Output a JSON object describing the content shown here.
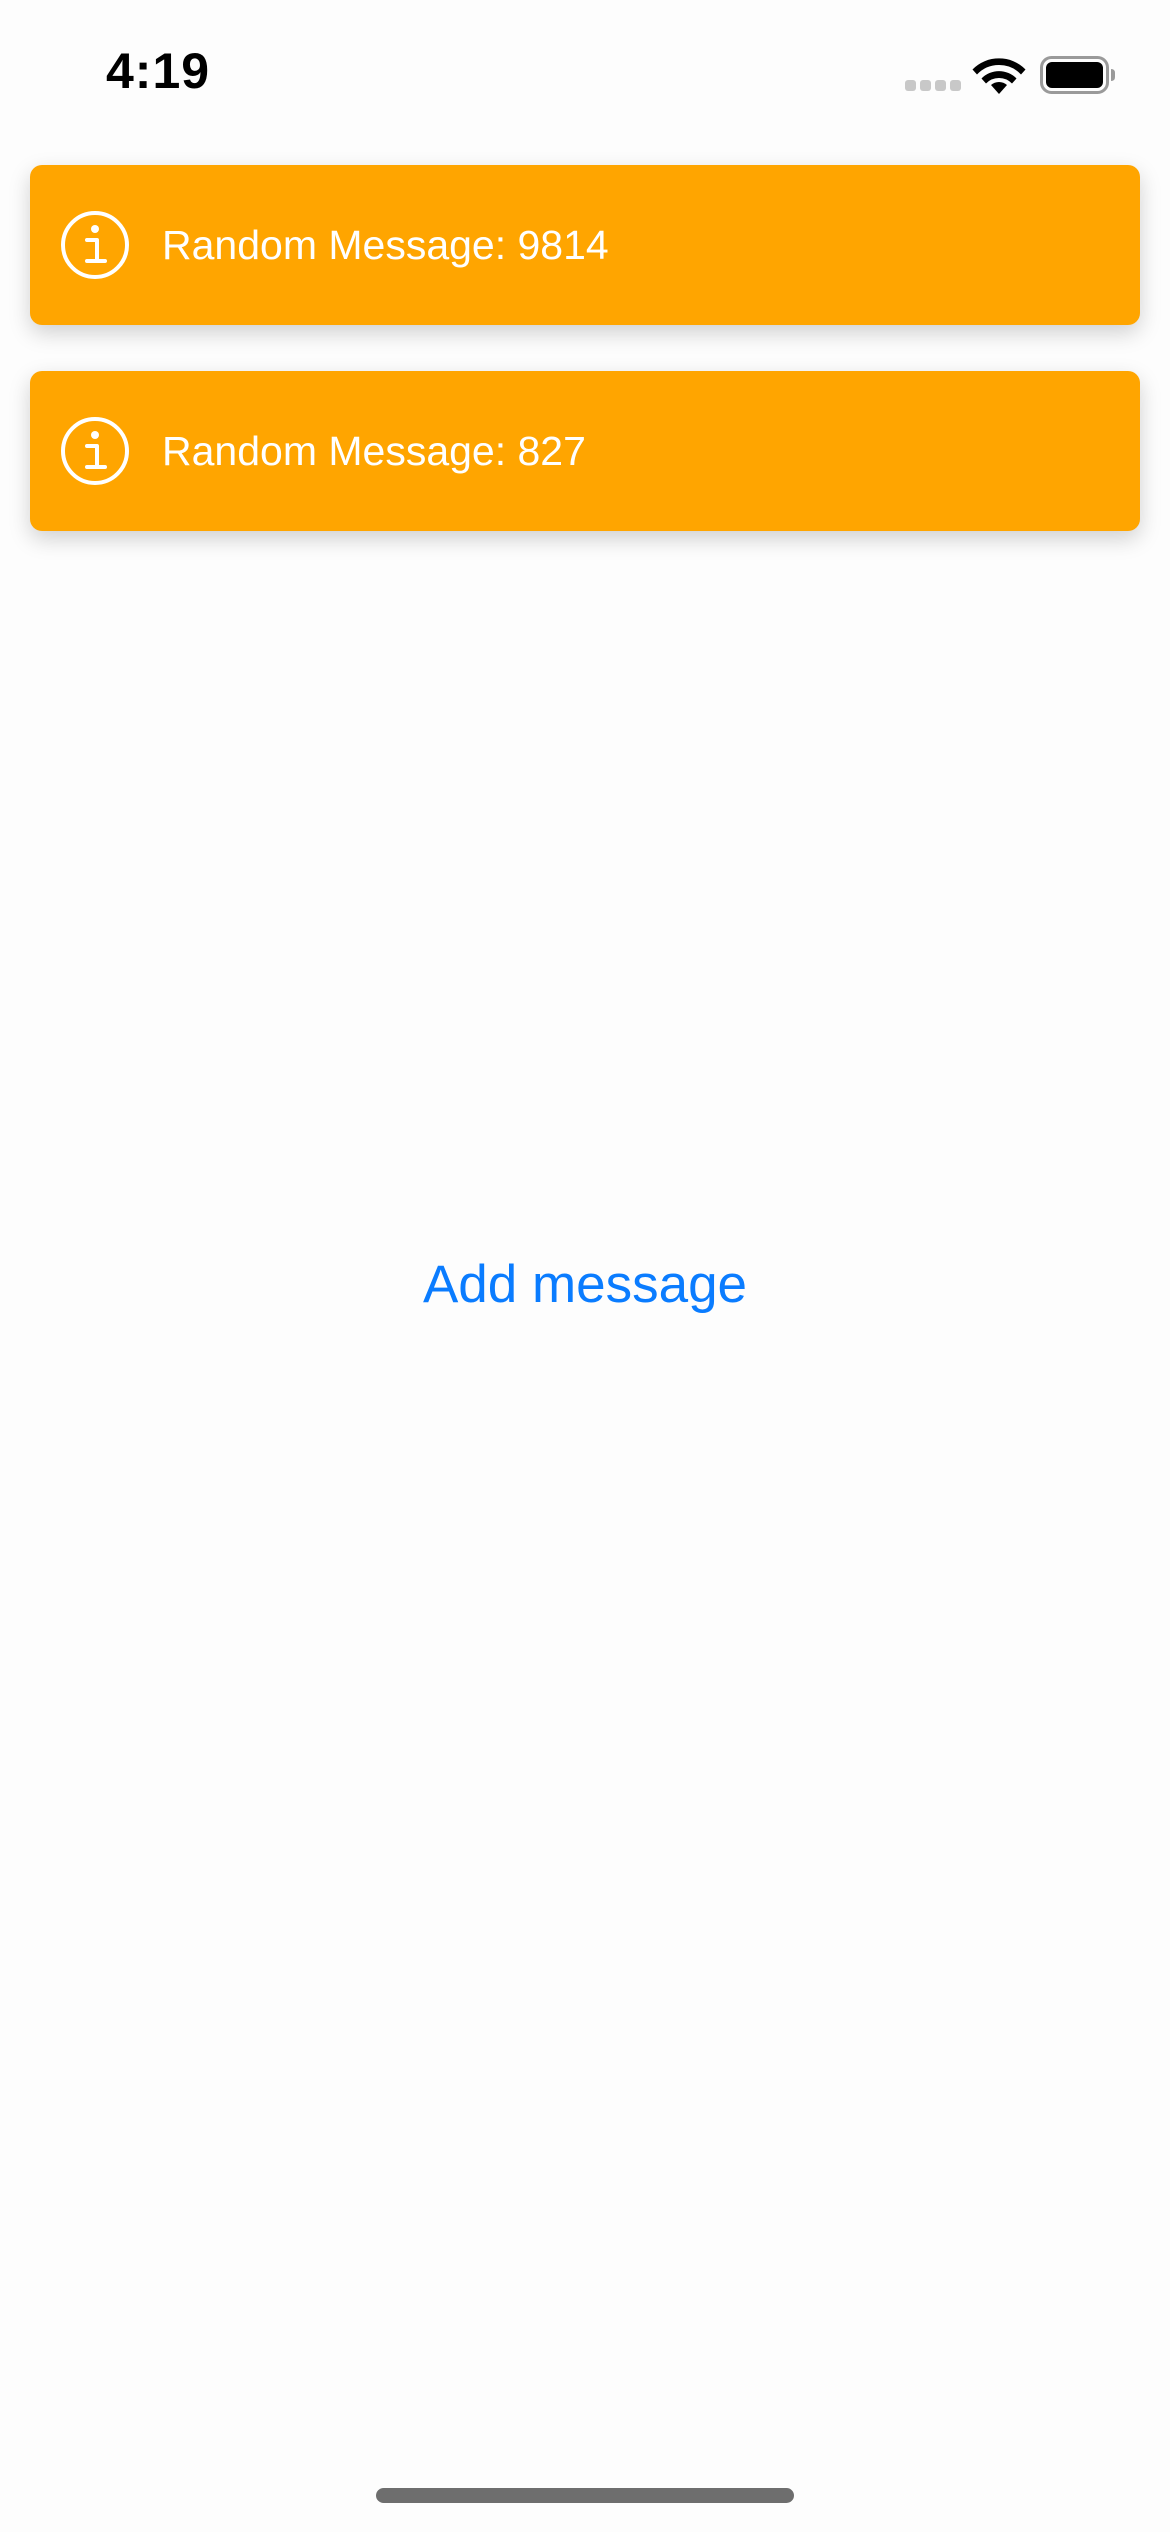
{
  "status_bar": {
    "time": "4:19"
  },
  "icons": {
    "signal": "cellular-signal-icon",
    "wifi": "wifi-icon",
    "battery": "battery-icon",
    "info": "info-circle-icon"
  },
  "colors": {
    "toast_background": "#FFA500",
    "toast_text": "#FFFFFF",
    "button_text": "#0A7CFF",
    "page_background": "#FDFDFD"
  },
  "messages": [
    {
      "text": "Random Message: 9814"
    },
    {
      "text": "Random Message: 827"
    }
  ],
  "actions": {
    "add_message_label": "Add message"
  }
}
